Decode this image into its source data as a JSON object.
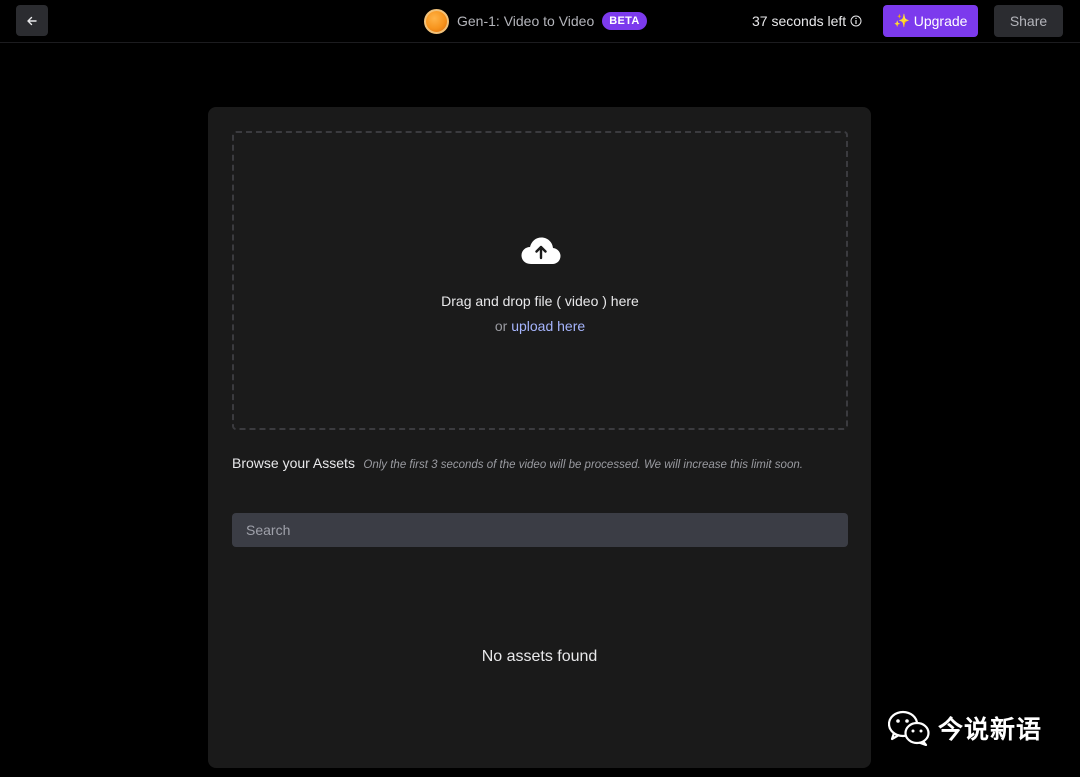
{
  "header": {
    "back_icon": "arrow-left-icon",
    "logo_icon": "orange-orb-logo",
    "app_title": "Gen-1: Video to Video",
    "badge": "BETA",
    "time_left": "37 seconds left",
    "info_icon": "info-circle-icon",
    "upgrade_label": "Upgrade",
    "upgrade_icon": "sparkles-icon",
    "share_label": "Share"
  },
  "upload": {
    "icon": "cloud-upload-icon",
    "instruction": "Drag and drop file ( video ) here",
    "or_text": "or",
    "link_text": "upload here"
  },
  "assets": {
    "title": "Browse your Assets",
    "note": "Only the first 3 seconds of the video will be processed. We will increase this limit soon.",
    "search_placeholder": "Search",
    "search_value": "",
    "empty_text": "No assets found"
  },
  "watermark": {
    "icon": "wechat-icon",
    "text": "今说新语"
  },
  "colors": {
    "background": "#000000",
    "panel": "#1a1a1a",
    "accent": "#7c3aed",
    "link": "#a5b4fc",
    "search_bg": "#3b3d45"
  }
}
